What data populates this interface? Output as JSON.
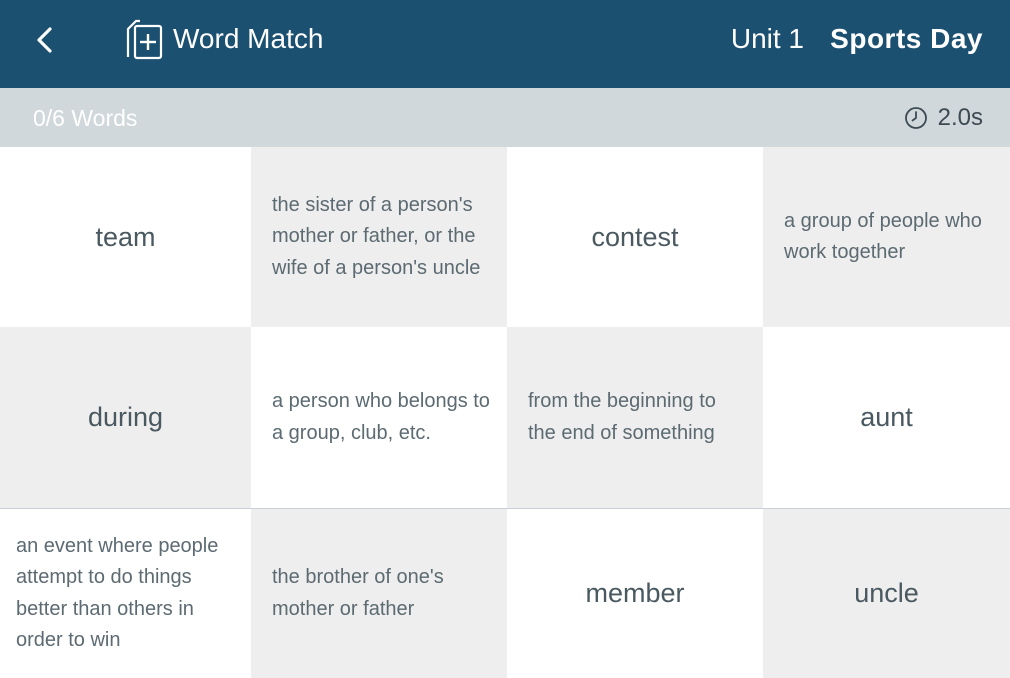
{
  "header": {
    "app_icon": "flashcard-plus-icon",
    "back_icon": "chevron-left-icon",
    "app_title": "Word Match",
    "unit": "Unit 1",
    "lesson": "Sports Day",
    "colors": {
      "bar": "#1b5071",
      "text": "#ffffff"
    }
  },
  "status": {
    "progress": "0/6 Words",
    "timer_icon": "clock-icon",
    "timer": "2.0s",
    "colors": {
      "bar": "#d0d8dc"
    }
  },
  "cards": [
    {
      "text": "team",
      "kind": "word"
    },
    {
      "text": "the sister of a person's mother or father, or the wife of a person's uncle",
      "kind": "definition"
    },
    {
      "text": "contest",
      "kind": "word"
    },
    {
      "text": "a group of people who work together",
      "kind": "definition"
    },
    {
      "text": "during",
      "kind": "word"
    },
    {
      "text": "a person who belongs to a group, club, etc.",
      "kind": "definition"
    },
    {
      "text": "from the beginning to the end of something",
      "kind": "definition"
    },
    {
      "text": "aunt",
      "kind": "word"
    },
    {
      "text": "an event where people attempt to do things better than others in order to win",
      "kind": "definition"
    },
    {
      "text": "the brother of one's mother or father",
      "kind": "definition"
    },
    {
      "text": "member",
      "kind": "word"
    },
    {
      "text": "uncle",
      "kind": "word"
    }
  ]
}
